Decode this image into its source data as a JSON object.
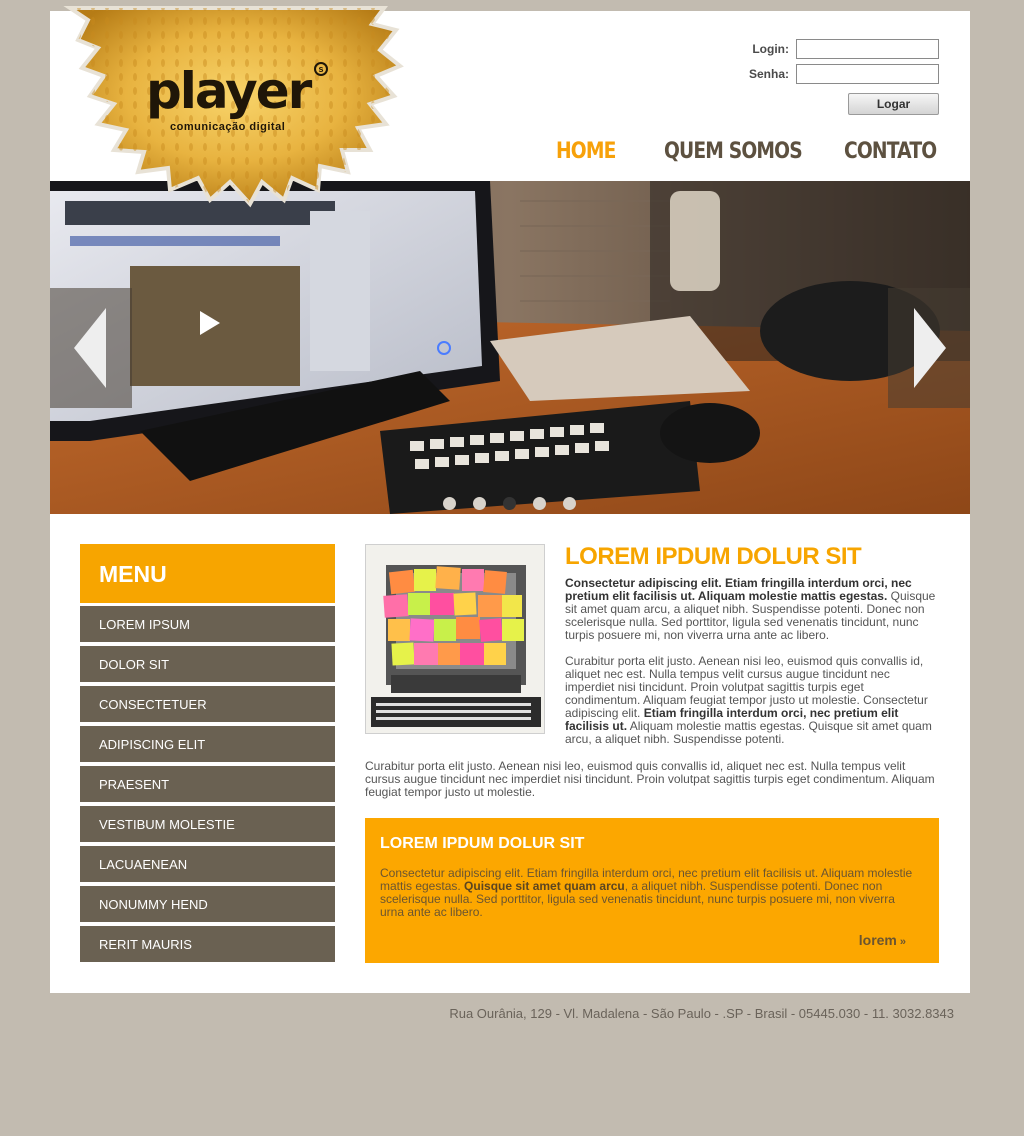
{
  "logo": {
    "name": "player",
    "superscript": "s",
    "tagline": "comunicação digital"
  },
  "login": {
    "login_label": "Login:",
    "login_value": "",
    "password_label": "Senha:",
    "password_value": "",
    "button_label": "Logar"
  },
  "nav": {
    "items": [
      {
        "label": "HOME",
        "active": true
      },
      {
        "label": "QUEM SOMOS",
        "active": false
      },
      {
        "label": "CONTATO",
        "active": false
      }
    ]
  },
  "slider": {
    "active_index": 2,
    "count": 5
  },
  "menu": {
    "title": "MENU",
    "items": [
      {
        "label": "LOREM IPSUM"
      },
      {
        "label": "DOLOR SIT"
      },
      {
        "label": "CONSECTETUER"
      },
      {
        "label": "ADIPISCING ELIT"
      },
      {
        "label": "PRAESENT"
      },
      {
        "label": "VESTIBUM MOLESTIE"
      },
      {
        "label": "LACUAENEAN"
      },
      {
        "label": "NONUMMY HEND"
      },
      {
        "label": "RERIT MAURIS"
      }
    ]
  },
  "article": {
    "title": "LOREM IPDUM DOLUR SIT",
    "p1_bold": "Consectetur adipiscing elit. Etiam fringilla interdum orci, nec pretium elit facilisis ut. Aliquam molestie mattis egestas.",
    "p1_rest": " Quisque sit amet quam arcu, a aliquet nibh. Suspendisse potenti. Donec non scelerisque nulla. Sed porttitor, ligula sed venenatis tincidunt, nunc turpis posuere mi, non viverra urna ante ac libero.",
    "p2_start": "Curabitur porta elit justo. Aenean nisi leo, euismod quis convallis id, aliquet nec est. Nulla tempus velit cursus augue tincidunt nec imperdiet nisi tincidunt. Proin volutpat sagittis turpis eget condimentum. Aliquam feugiat tempor justo ut molestie. Consectetur adipiscing elit.",
    "p2_bold": " Etiam fringilla interdum orci, nec pretium elit facilisis ut.",
    "p2_end": " Aliquam molestie mattis egestas. Quisque sit amet quam arcu, a aliquet nibh. Suspendisse potenti.",
    "p3": "Curabitur porta elit justo. Aenean nisi leo, euismod quis convallis id, aliquet nec est. Nulla tempus velit cursus augue tincidunt nec imperdiet nisi tincidunt. Proin volutpat sagittis turpis eget condimentum. Aliquam feugiat tempor justo ut molestie."
  },
  "box": {
    "title": "LOREM IPDUM DOLUR SIT",
    "text_start": "Consectetur adipiscing elit. Etiam fringilla interdum orci, nec pretium elit facilisis ut. Aliquam molestie mattis egestas.",
    "text_bold": " Quisque sit amet quam arcu",
    "text_end": ", a aliquet nibh. Suspendisse potenti. Donec non scelerisque nulla. Sed porttitor, ligula sed venenatis tincidunt, nunc turpis posuere mi, non viverra urna ante ac libero.",
    "link_label": "lorem",
    "link_icon": "»"
  },
  "footer": {
    "address": "Rua Ourânia, 129 - Vl. Madalena - São Paulo - .SP - Brasil - 05445.030 - 11. 3032.8343"
  },
  "colors": {
    "accent": "#f7a500",
    "menu_bg": "#6a6152",
    "nav_text": "#5d5140",
    "page_bg": "#c2bbb0"
  }
}
